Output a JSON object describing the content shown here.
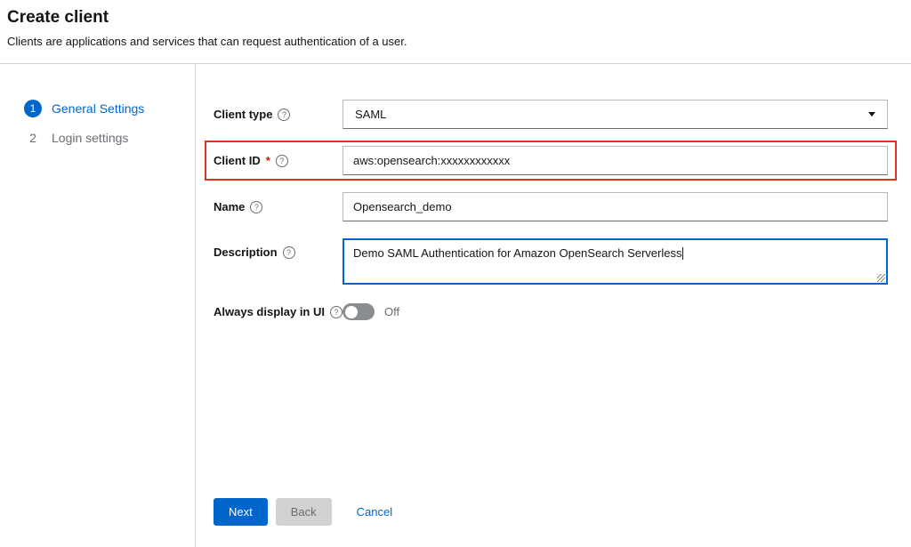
{
  "header": {
    "title": "Create client",
    "subtitle": "Clients are applications and services that can request authentication of a user."
  },
  "wizard": {
    "steps": [
      {
        "number": "1",
        "label": "General Settings"
      },
      {
        "number": "2",
        "label": "Login settings"
      }
    ]
  },
  "form": {
    "client_type": {
      "label": "Client type",
      "value": "SAML"
    },
    "client_id": {
      "label": "Client ID",
      "required_marker": "*",
      "value": "aws:opensearch:xxxxxxxxxxxx"
    },
    "name": {
      "label": "Name",
      "value": "Opensearch_demo"
    },
    "description": {
      "label": "Description",
      "value": "Demo SAML Authentication for Amazon OpenSearch Serverless"
    },
    "always_display": {
      "label": "Always display in UI",
      "state": "Off"
    }
  },
  "actions": {
    "next": "Next",
    "back": "Back",
    "cancel": "Cancel"
  },
  "colors": {
    "primary": "#0066CC",
    "annotation": "#e0301e",
    "required": "#c9190b"
  }
}
